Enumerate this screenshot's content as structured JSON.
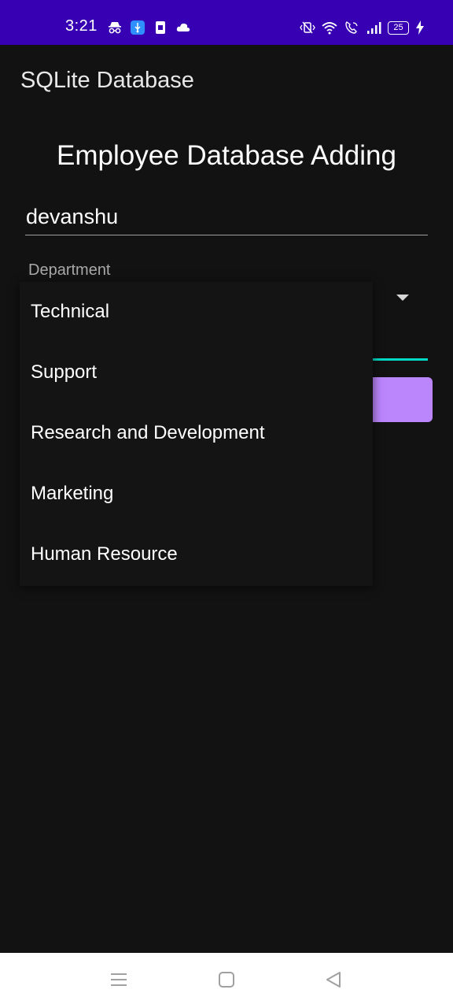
{
  "status_bar": {
    "time": "3:21",
    "battery_level": "25",
    "background_color": "#3700B3",
    "left_icons": [
      "incognito-icon",
      "usb-icon",
      "sim-icon",
      "cloud-icon"
    ],
    "right_icons": [
      "vibrate-icon",
      "wifi-icon",
      "wifi-calling-icon",
      "signal-icon",
      "battery-icon",
      "charging-icon"
    ]
  },
  "app_bar": {
    "title": "SQLite Database"
  },
  "form": {
    "heading": "Employee Database Adding",
    "name_value": "devanshu",
    "department_label": "Department"
  },
  "dropdown": {
    "options": [
      "Technical",
      "Support",
      "Research and Development",
      "Marketing",
      "Human Resource"
    ]
  },
  "colors": {
    "accent_underline": "#03DAC5",
    "button": "#BB86FC",
    "background": "#121212"
  },
  "nav_bar": {
    "buttons": [
      "menu-icon",
      "home-icon",
      "back-icon"
    ]
  }
}
